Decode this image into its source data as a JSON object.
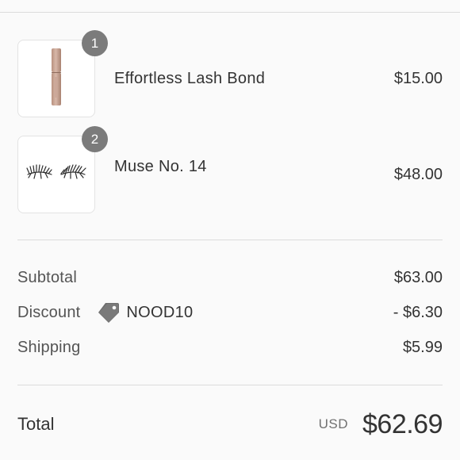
{
  "items": [
    {
      "quantity": "1",
      "name": "Effortless Lash Bond",
      "price": "$15.00",
      "image_icon": "lash-bond-tube-icon"
    },
    {
      "quantity": "2",
      "name": "Muse No. 14",
      "price": "$48.00",
      "image_icon": "false-lashes-icon"
    }
  ],
  "summary": {
    "subtotal_label": "Subtotal",
    "subtotal_value": "$63.00",
    "discount_label": "Discount",
    "discount_code": "NOOD10",
    "discount_value": "- $6.30",
    "shipping_label": "Shipping",
    "shipping_value": "$5.99"
  },
  "total": {
    "label": "Total",
    "currency": "USD",
    "amount": "$62.69"
  },
  "colors": {
    "badge": "#7b7b7b",
    "divider": "#dcdcdc",
    "background": "#fafafa",
    "tube": "#c9a698"
  }
}
